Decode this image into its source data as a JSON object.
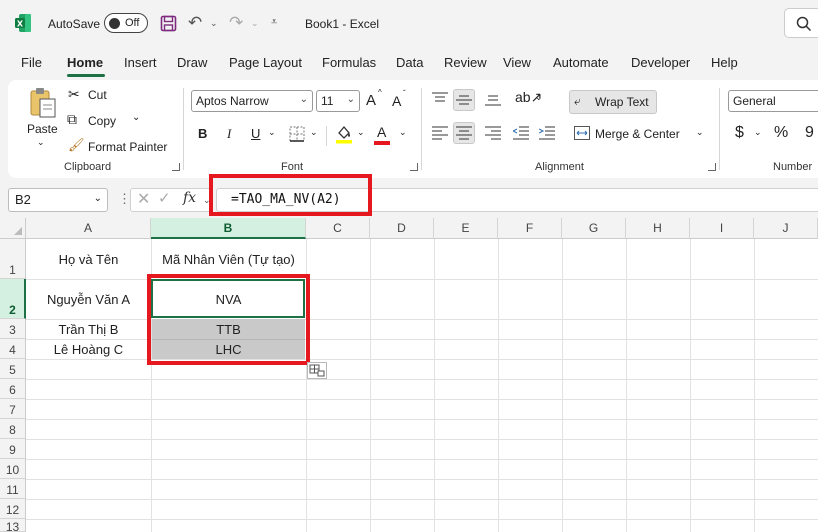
{
  "titlebar": {
    "autosave_label": "AutoSave",
    "autosave_state": "Off",
    "doc_title": "Book1  -  Excel"
  },
  "tabs": [
    "File",
    "Home",
    "Insert",
    "Draw",
    "Page Layout",
    "Formulas",
    "Data",
    "Review",
    "View",
    "Automate",
    "Developer",
    "Help"
  ],
  "active_tab": "Home",
  "ribbon": {
    "clipboard": {
      "paste": "Paste",
      "cut": "Cut",
      "copy": "Copy",
      "format_painter": "Format Painter",
      "group_label": "Clipboard"
    },
    "font": {
      "font_name": "Aptos Narrow",
      "font_size": "11",
      "grow": "A",
      "shrink": "A",
      "bold": "B",
      "italic": "I",
      "underline": "U",
      "font_color_letter": "A",
      "group_label": "Font"
    },
    "alignment": {
      "wrap_text": "Wrap Text",
      "merge_center": "Merge & Center",
      "group_label": "Alignment"
    },
    "number": {
      "format": "General",
      "currency": "$",
      "percent": "%",
      "group_label": "Number"
    }
  },
  "formula_bar": {
    "name_box": "B2",
    "fx": "fx",
    "formula": "=TAO_MA_NV(A2)"
  },
  "columns": [
    "A",
    "B",
    "C",
    "D",
    "E",
    "F",
    "G",
    "H",
    "I",
    "J"
  ],
  "rows": [
    "1",
    "2",
    "3",
    "4",
    "5",
    "6",
    "7",
    "8",
    "9",
    "10",
    "11",
    "12",
    "13"
  ],
  "cells": {
    "A1": "Họ và Tên",
    "B1": "Mã Nhân Viên (Tự tạo)",
    "A2": "Nguyễn Văn A",
    "B2": "NVA",
    "A3": "Trần Thị B",
    "B3": "TTB",
    "A4": "Lê Hoàng C",
    "B4": "LHC"
  },
  "colors": {
    "accent": "#1e7145",
    "highlight": "#e5181f",
    "fill_gray": "#c9c9c9"
  }
}
